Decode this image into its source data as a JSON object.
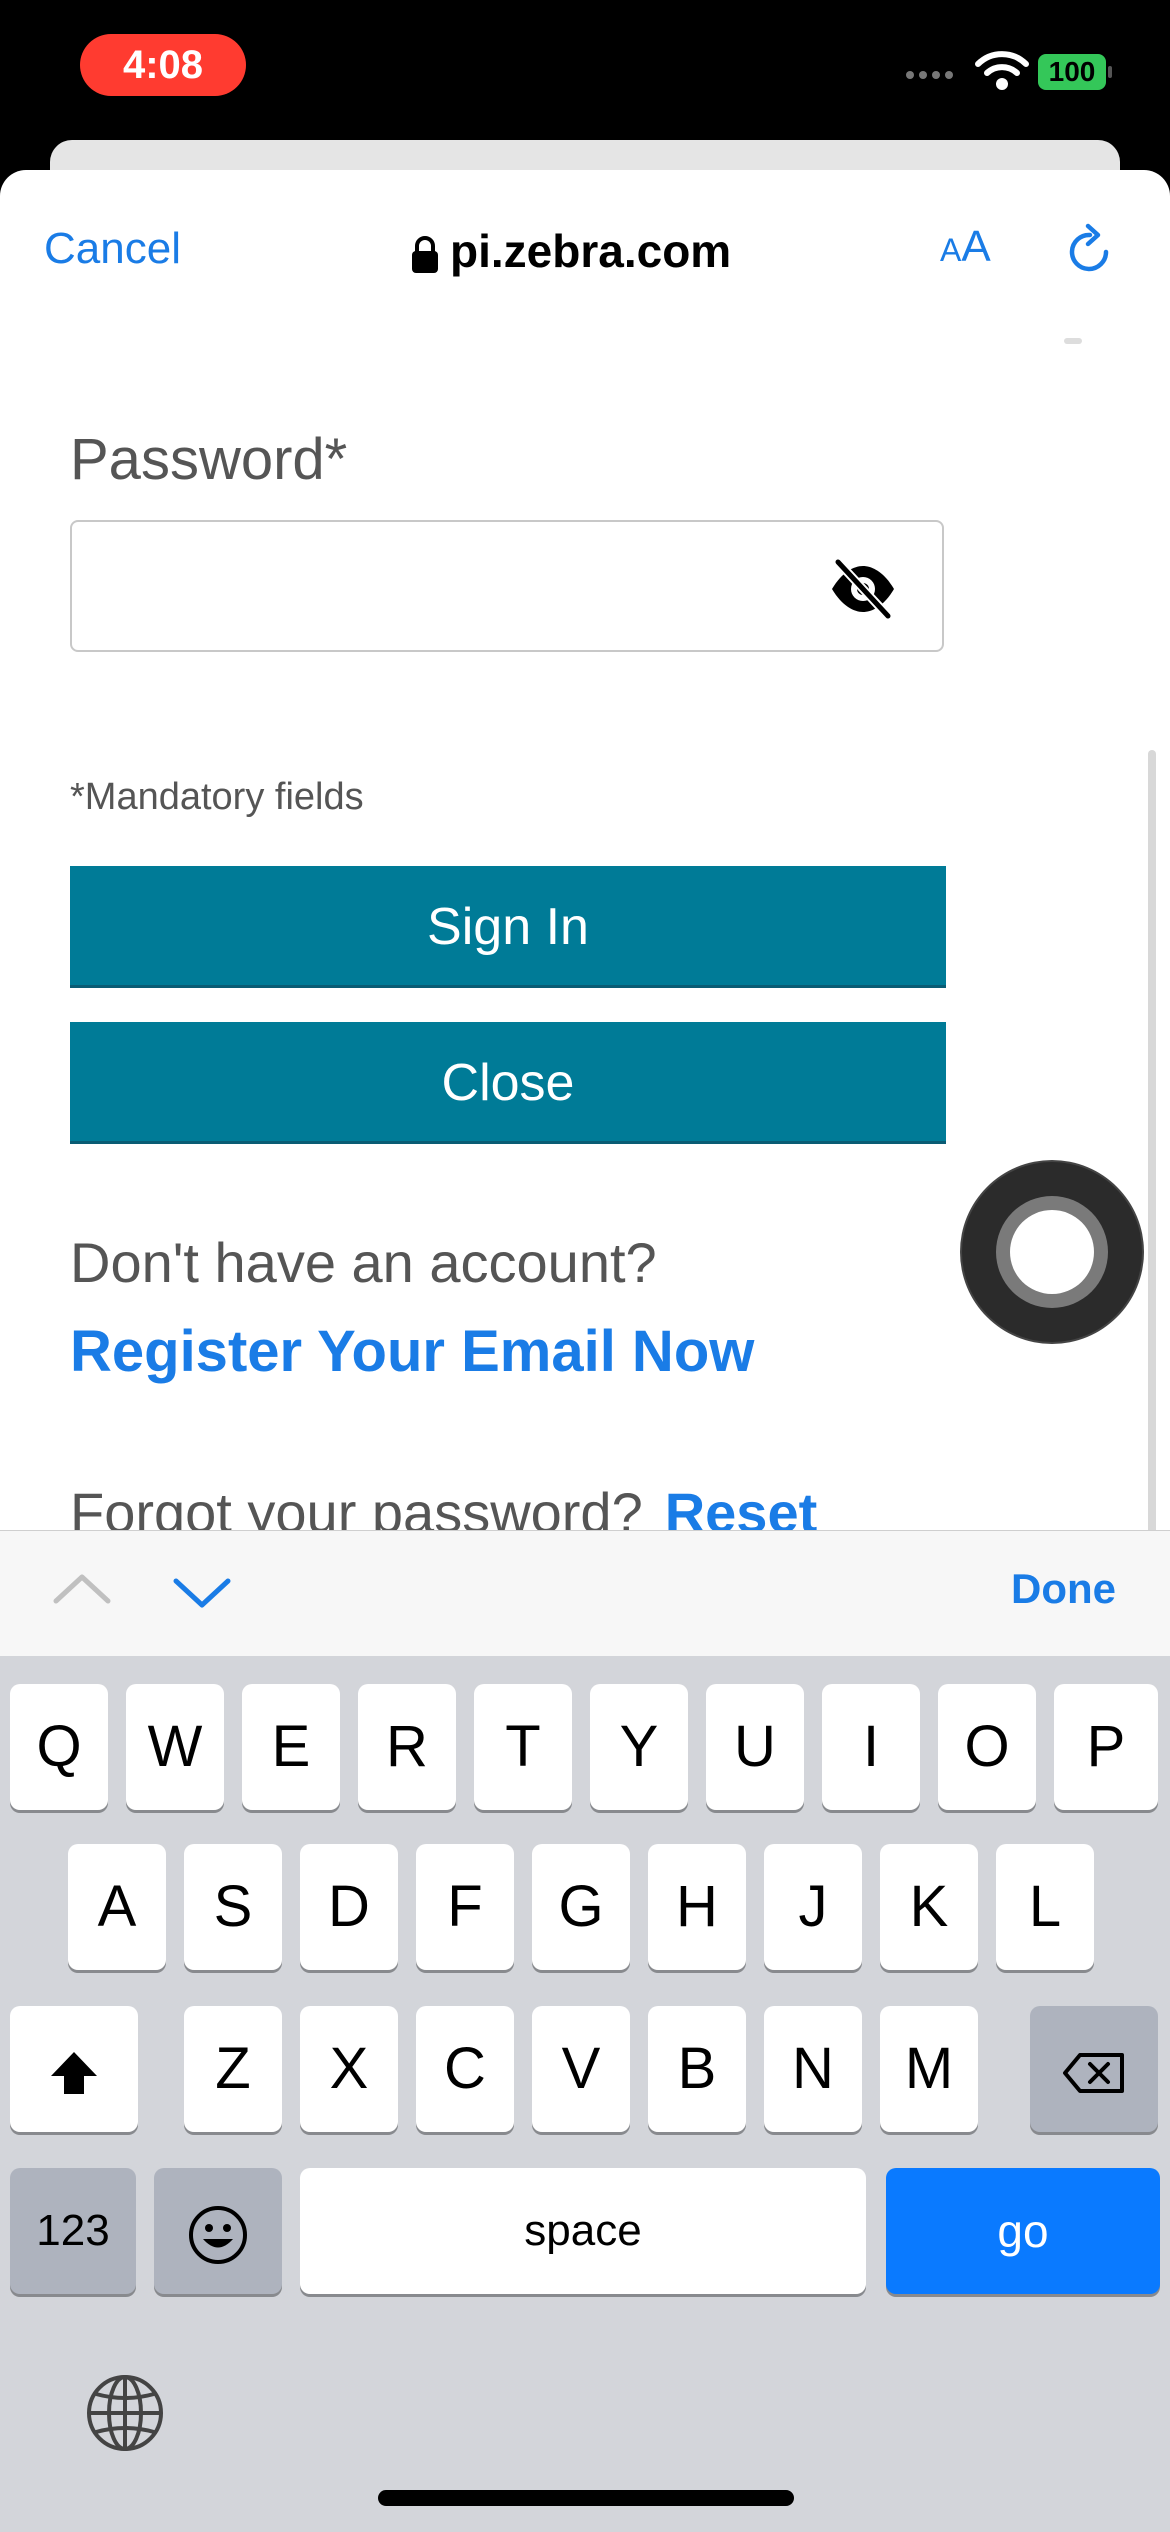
{
  "status_bar": {
    "time": "4:08",
    "battery": "100"
  },
  "browser_nav": {
    "cancel_label": "Cancel",
    "url": "pi.zebra.com",
    "aa_small": "A",
    "aa_big": "A"
  },
  "form": {
    "password_label": "Password*",
    "password_value": "",
    "mandatory_note": "*Mandatory fields",
    "signin_label": "Sign In",
    "close_label": "Close",
    "no_account_text": "Don't have an account?",
    "register_link": "Register Your Email Now",
    "forgot_text": "Forgot your password?",
    "reset_link": "Reset"
  },
  "accessory_bar": {
    "done_label": "Done"
  },
  "keyboard": {
    "row1": [
      "Q",
      "W",
      "E",
      "R",
      "T",
      "Y",
      "U",
      "I",
      "O",
      "P"
    ],
    "row2": [
      "A",
      "S",
      "D",
      "F",
      "G",
      "H",
      "J",
      "K",
      "L"
    ],
    "row3": [
      "Z",
      "X",
      "C",
      "V",
      "B",
      "N",
      "M"
    ],
    "numbers_label": "123",
    "space_label": "space",
    "go_label": "go"
  },
  "colors": {
    "accent": "#1a7ce6",
    "button_teal": "#007b97",
    "time_pill": "#ff3b30",
    "battery": "#34c759",
    "go_key": "#0a7aff"
  },
  "icons": [
    "lock-icon",
    "reload-icon",
    "eye-off-icon",
    "chevron-up-icon",
    "chevron-down-icon",
    "shift-icon",
    "backspace-icon",
    "emoji-icon",
    "globe-icon",
    "wifi-icon"
  ]
}
